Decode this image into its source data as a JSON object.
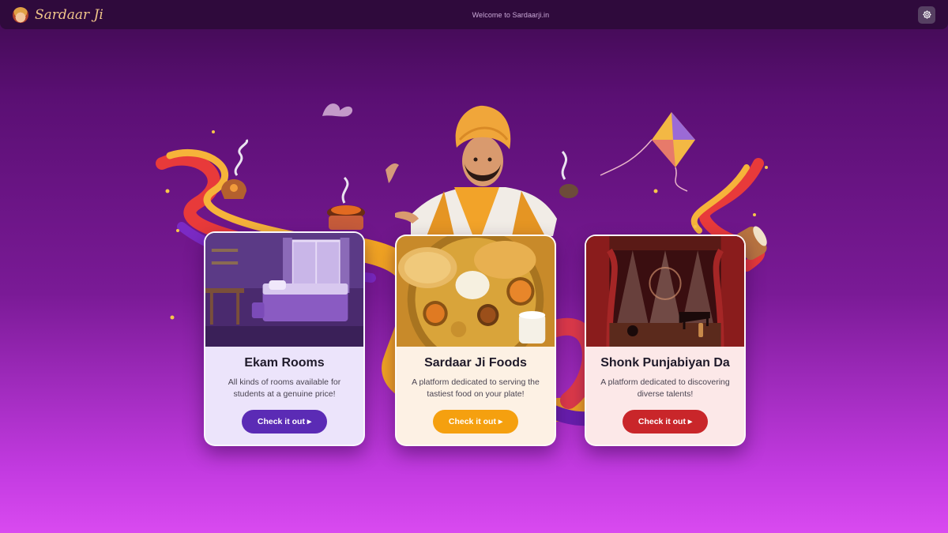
{
  "header": {
    "brand_name": "Sardaar Ji",
    "welcome_text": "Welcome to Sardaarji.in",
    "settings_icon": "gear-icon"
  },
  "cards": [
    {
      "title": "Ekam Rooms",
      "description": "All kinds of rooms available for students at a genuine price!",
      "button_label": "Check it out ▸",
      "button_color": "#5b2bb5",
      "card_bg": "#ece4fb"
    },
    {
      "title": "Sardaar Ji Foods",
      "description": "A platform dedicated to serving the tastiest food on your plate!",
      "button_label": "Check it out ▸",
      "button_color": "#f5a00f",
      "card_bg": "#fdf1e4"
    },
    {
      "title": "Shonk Punjabiyan Da",
      "description": "A platform dedicated to discovering diverse talents!",
      "button_label": "Check it out ▸",
      "button_color": "#c9262a",
      "card_bg": "#fce8e8"
    }
  ]
}
